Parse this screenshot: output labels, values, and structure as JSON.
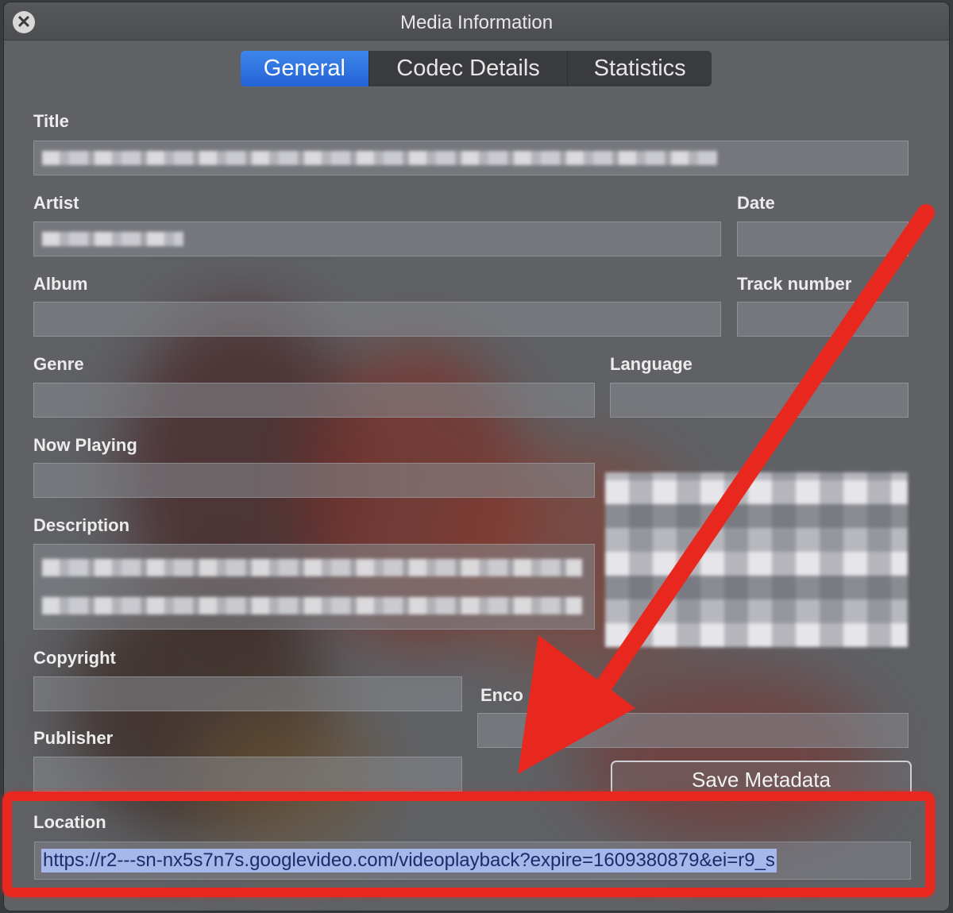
{
  "window": {
    "title": "Media Information"
  },
  "tabs": [
    {
      "label": "General",
      "active": true
    },
    {
      "label": "Codec Details",
      "active": false
    },
    {
      "label": "Statistics",
      "active": false
    }
  ],
  "fields": {
    "title": {
      "label": "Title",
      "value": ""
    },
    "artist": {
      "label": "Artist",
      "value": ""
    },
    "date": {
      "label": "Date",
      "value": ""
    },
    "album": {
      "label": "Album",
      "value": ""
    },
    "track_number": {
      "label": "Track number",
      "value": ""
    },
    "genre": {
      "label": "Genre",
      "value": ""
    },
    "language": {
      "label": "Language",
      "value": ""
    },
    "now_playing": {
      "label": "Now Playing",
      "value": ""
    },
    "description": {
      "label": "Description",
      "value": ""
    },
    "copyright": {
      "label": "Copyright",
      "value": ""
    },
    "encoded_by": {
      "label": "Enco",
      "value": ""
    },
    "publisher": {
      "label": "Publisher",
      "value": ""
    },
    "location": {
      "label": "Location",
      "value": "https://r2---sn-nx5s7n7s.googlevideo.com/videoplayback?expire=1609380879&ei=r9_s"
    }
  },
  "buttons": {
    "save_metadata": "Save Metadata"
  },
  "annotation": {
    "color": "#e8281f"
  },
  "colors": {
    "accent": "#2b6fe0",
    "selection": "#a6b7ea"
  }
}
